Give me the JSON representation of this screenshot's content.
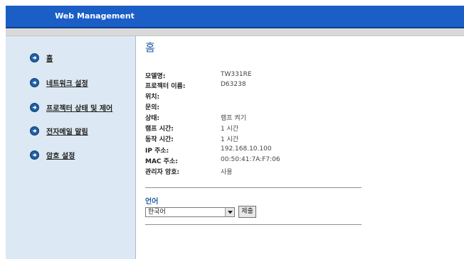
{
  "header": {
    "title": "Web Management"
  },
  "sidebar": {
    "items": [
      {
        "label": "홈"
      },
      {
        "label": "네트워크 설정"
      },
      {
        "label": "프로젝터 상태 및 제어"
      },
      {
        "label": "전자메일 알림"
      },
      {
        "label": "암호 설정"
      }
    ]
  },
  "main": {
    "title": "홈",
    "info": [
      {
        "label": "모델명:",
        "value": "TW331RE"
      },
      {
        "label": "프로젝터 이름:",
        "value": "D63238"
      },
      {
        "label": "위치:",
        "value": ""
      },
      {
        "label": "문의:",
        "value": ""
      },
      {
        "label": "상태:",
        "value": "램프 켜기"
      },
      {
        "label": "램프 시간:",
        "value": "1 시간"
      },
      {
        "label": "동작 시간:",
        "value": "1 시간"
      },
      {
        "label": "IP 주소:",
        "value": "192.168.10.100"
      },
      {
        "label": "MAC 주소:",
        "value": "00:50:41:7A:F7:06"
      },
      {
        "label": "관리자 암호:",
        "value": "사용"
      }
    ],
    "language": {
      "title": "언어",
      "selected": "한국어",
      "submit_label": "제출"
    }
  },
  "colors": {
    "header_blue": "#1a5ec6",
    "sidebar_bg": "#dce8f3",
    "accent_blue": "#1f5fa6"
  },
  "icons": {
    "sidebar_bullet": "arrow-right-circle-icon",
    "select_arrow": "chevron-down-icon"
  }
}
